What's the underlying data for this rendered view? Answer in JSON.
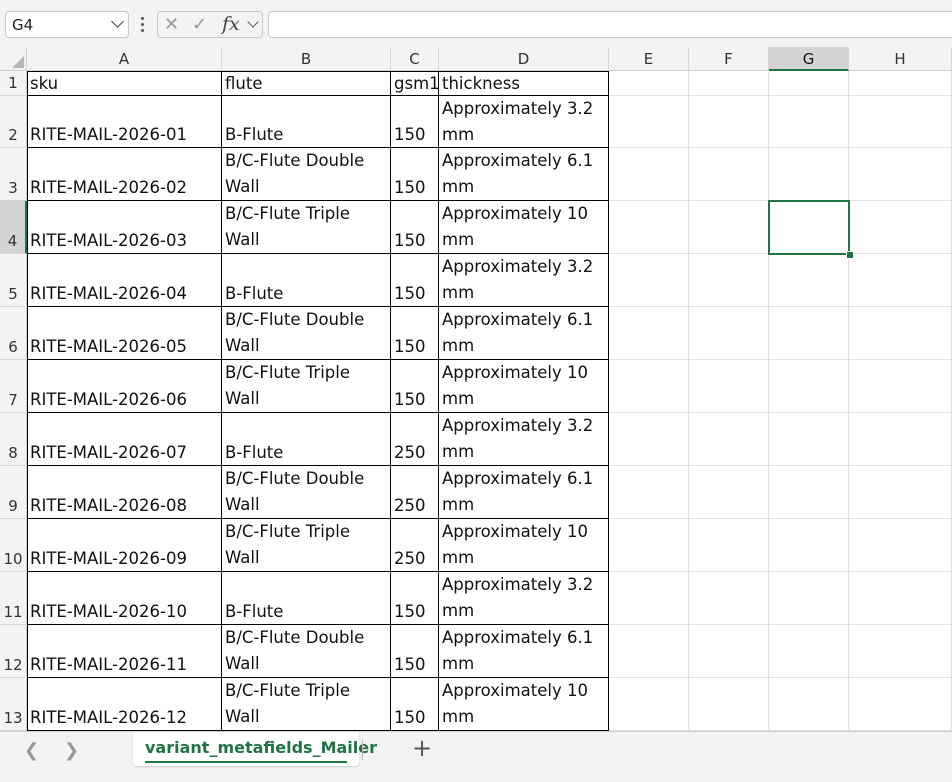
{
  "name_box": {
    "value": "G4"
  },
  "formula": {
    "fx_label": "fx",
    "value": ""
  },
  "columns": [
    "A",
    "B",
    "C",
    "D",
    "E",
    "F",
    "G",
    "H"
  ],
  "selected_cell": "G4",
  "rows": [
    {
      "num": "1",
      "sku": "sku",
      "flute": "flute",
      "gsm": "gsm1",
      "thickness": "thickness"
    },
    {
      "num": "2",
      "sku": "RITE-MAIL-2026-01",
      "flute": "B-Flute",
      "gsm": "150",
      "thickness": "Approximately 3.2 mm"
    },
    {
      "num": "3",
      "sku": "RITE-MAIL-2026-02",
      "flute": "B/C-Flute Double Wall",
      "gsm": "150",
      "thickness": "Approximately 6.1 mm"
    },
    {
      "num": "4",
      "sku": "RITE-MAIL-2026-03",
      "flute": "B/C-Flute Triple Wall",
      "gsm": "150",
      "thickness": "Approximately 10 mm"
    },
    {
      "num": "5",
      "sku": "RITE-MAIL-2026-04",
      "flute": "B-Flute",
      "gsm": "150",
      "thickness": "Approximately 3.2 mm"
    },
    {
      "num": "6",
      "sku": "RITE-MAIL-2026-05",
      "flute": "B/C-Flute Double Wall",
      "gsm": "150",
      "thickness": "Approximately 6.1 mm"
    },
    {
      "num": "7",
      "sku": "RITE-MAIL-2026-06",
      "flute": "B/C-Flute Triple Wall",
      "gsm": "150",
      "thickness": "Approximately 10 mm"
    },
    {
      "num": "8",
      "sku": "RITE-MAIL-2026-07",
      "flute": "B-Flute",
      "gsm": "250",
      "thickness": "Approximately 3.2 mm"
    },
    {
      "num": "9",
      "sku": "RITE-MAIL-2026-08",
      "flute": "B/C-Flute Double Wall",
      "gsm": "250",
      "thickness": "Approximately 6.1 mm"
    },
    {
      "num": "10",
      "sku": "RITE-MAIL-2026-09",
      "flute": "B/C-Flute Triple Wall",
      "gsm": "250",
      "thickness": "Approximately 10 mm"
    },
    {
      "num": "11",
      "sku": "RITE-MAIL-2026-10",
      "flute": "B-Flute",
      "gsm": "150",
      "thickness": "Approximately 3.2 mm"
    },
    {
      "num": "12",
      "sku": "RITE-MAIL-2026-11",
      "flute": "B/C-Flute Double Wall",
      "gsm": "150",
      "thickness": "Approximately 6.1 mm"
    },
    {
      "num": "13",
      "sku": "RITE-MAIL-2026-12",
      "flute": "B/C-Flute Triple Wall",
      "gsm": "150",
      "thickness": "Approximately 10 mm"
    }
  ],
  "sheet_tabs": {
    "active": "variant_metafields_Mailer",
    "add_label": "+"
  },
  "colors": {
    "accent": "#217346",
    "grid": "#e1e1e1",
    "header_bg": "#f3f3f3"
  },
  "icons": {
    "name_box_dropdown": "chevron-down-icon",
    "more": "vertical-dots-icon",
    "cancel": "x-icon",
    "enter": "check-icon",
    "function": "fx-icon",
    "prev_sheet": "chevron-left-icon",
    "next_sheet": "chevron-right-icon",
    "add_sheet": "plus-icon"
  }
}
